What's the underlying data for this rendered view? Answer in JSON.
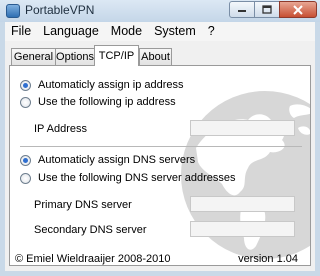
{
  "window": {
    "title": "PortableVPN"
  },
  "menu": [
    "File",
    "Language",
    "Mode",
    "System",
    "?"
  ],
  "tabs": [
    {
      "label": "General",
      "active": false
    },
    {
      "label": "Options",
      "active": false
    },
    {
      "label": "TCP/IP",
      "active": true
    },
    {
      "label": "About",
      "active": false
    }
  ],
  "ip": {
    "auto_label": "Automaticly assign ip address",
    "auto_selected": true,
    "manual_label": "Use the following ip address",
    "address_label": "IP Address",
    "address_value": ""
  },
  "dns": {
    "auto_label": "Automaticly assign DNS servers",
    "auto_selected": true,
    "manual_label": "Use the following DNS server addresses",
    "primary_label": "Primary DNS server",
    "primary_value": "",
    "secondary_label": "Secondary DNS server",
    "secondary_value": ""
  },
  "footer": {
    "copyright": "© Emiel Wieldraaijer 2008-2010",
    "version": "version 1.04"
  }
}
